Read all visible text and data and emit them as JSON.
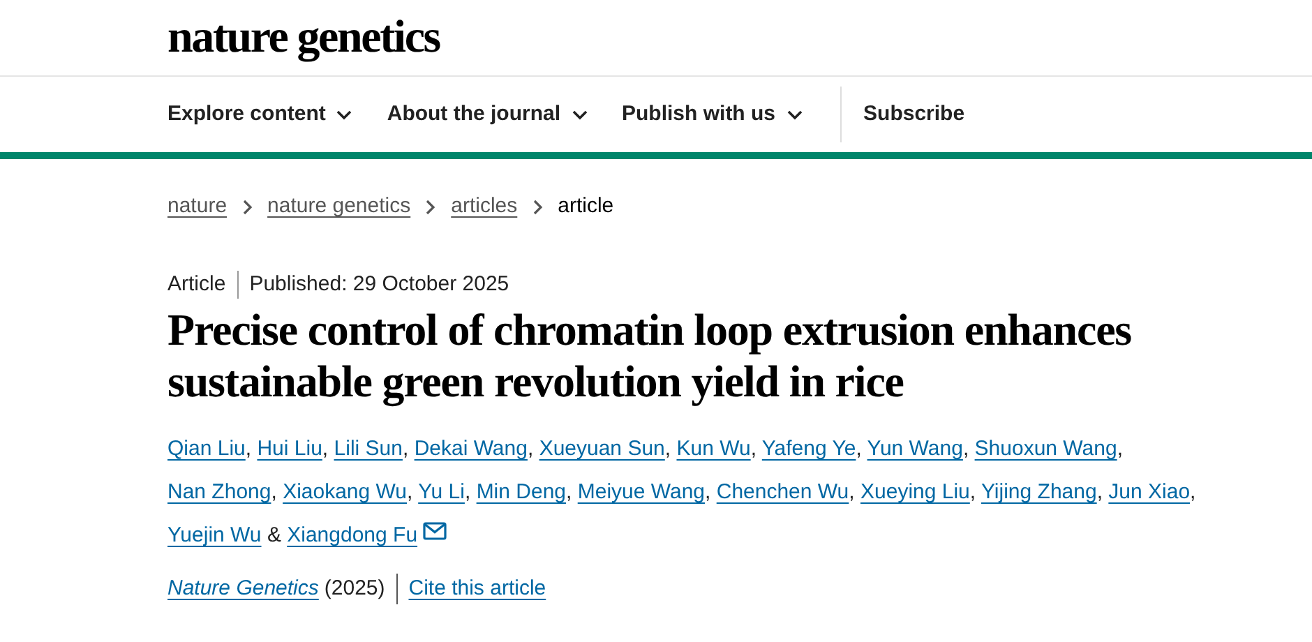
{
  "logo": "nature genetics",
  "nav": [
    {
      "label": "Explore content",
      "dropdown": true
    },
    {
      "label": "About the journal",
      "dropdown": true
    },
    {
      "label": "Publish with us",
      "dropdown": true
    },
    {
      "label": "Subscribe",
      "dropdown": false
    }
  ],
  "breadcrumbs": [
    {
      "label": "nature",
      "current": false
    },
    {
      "label": "nature genetics",
      "current": false
    },
    {
      "label": "articles",
      "current": false
    },
    {
      "label": "article",
      "current": true
    }
  ],
  "article_type": "Article",
  "published": "Published: 29 October 2025",
  "title": "Precise control of chromatin loop extrusion enhances sustainable green revolution yield in rice",
  "authors": [
    {
      "name": "Qian Liu",
      "sep": ","
    },
    {
      "name": "Hui Liu",
      "sep": ","
    },
    {
      "name": "Lili Sun",
      "sep": ","
    },
    {
      "name": "Dekai Wang",
      "sep": ","
    },
    {
      "name": "Xueyuan Sun",
      "sep": ","
    },
    {
      "name": "Kun Wu",
      "sep": ","
    },
    {
      "name": "Yafeng Ye",
      "sep": ","
    },
    {
      "name": "Yun Wang",
      "sep": ","
    },
    {
      "name": "Shuoxun Wang",
      "sep": ","
    },
    {
      "name": "Nan Zhong",
      "sep": ","
    },
    {
      "name": "Xiaokang Wu",
      "sep": ","
    },
    {
      "name": "Yu Li",
      "sep": ","
    },
    {
      "name": "Min Deng",
      "sep": ","
    },
    {
      "name": "Meiyue Wang",
      "sep": ","
    },
    {
      "name": "Chenchen Wu",
      "sep": ","
    },
    {
      "name": "Xueying Liu",
      "sep": ","
    },
    {
      "name": "Yijing Zhang",
      "sep": ","
    },
    {
      "name": "Jun Xiao",
      "sep": ","
    },
    {
      "name": "Yuejin Wu",
      "sep": "&"
    },
    {
      "name": "Xiangdong Fu",
      "email": true
    }
  ],
  "citation": {
    "journal": "Nature Genetics",
    "year": "(2025)",
    "cite_link": "Cite this article"
  }
}
